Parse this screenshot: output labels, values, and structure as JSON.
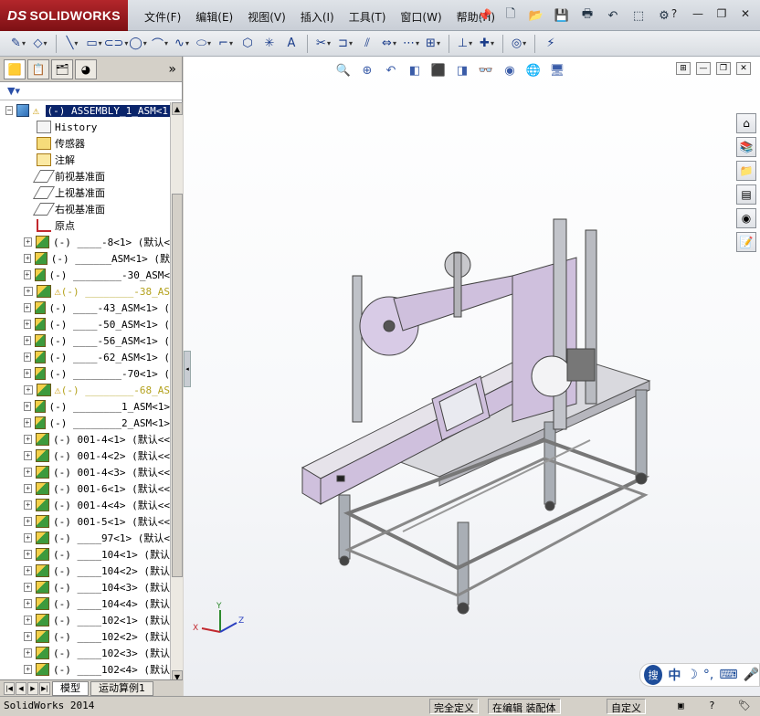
{
  "app": {
    "brand": "SOLIDWORKS",
    "brand_prefix": "DS"
  },
  "menu": [
    "文件(F)",
    "编辑(E)",
    "视图(V)",
    "插入(I)",
    "工具(T)",
    "窗口(W)",
    "帮助(H)"
  ],
  "feature_tree": {
    "root_label": "(-) ASSEMBLY_1_ASM<1",
    "items": [
      {
        "label": "History",
        "kind": "history",
        "indent": 2
      },
      {
        "label": "传感器",
        "kind": "sensor",
        "indent": 2
      },
      {
        "label": "注解",
        "kind": "annotation",
        "indent": 2
      },
      {
        "label": "前视基准面",
        "kind": "plane",
        "indent": 2
      },
      {
        "label": "上视基准面",
        "kind": "plane",
        "indent": 2
      },
      {
        "label": "右视基准面",
        "kind": "plane",
        "indent": 2
      },
      {
        "label": "原点",
        "kind": "origin",
        "indent": 2
      },
      {
        "label": "(-) ____-8<1> (默认<",
        "kind": "asm",
        "indent": 1
      },
      {
        "label": "(-) ______ASM<1> (默",
        "kind": "asm",
        "indent": 1
      },
      {
        "label": "(-) ________-30_ASM<",
        "kind": "asm",
        "indent": 1
      },
      {
        "label": "(-) ________-38_AS",
        "kind": "warn",
        "indent": 1
      },
      {
        "label": "(-) ____-43_ASM<1> (",
        "kind": "asm",
        "indent": 1
      },
      {
        "label": "(-) ____-50_ASM<1> (",
        "kind": "asm",
        "indent": 1
      },
      {
        "label": "(-) ____-56_ASM<1> (",
        "kind": "asm",
        "indent": 1
      },
      {
        "label": "(-) ____-62_ASM<1> (",
        "kind": "asm",
        "indent": 1
      },
      {
        "label": "(-) ________-70<1> (",
        "kind": "asm",
        "indent": 1
      },
      {
        "label": "(-) ________-68_AS",
        "kind": "warn",
        "indent": 1
      },
      {
        "label": "(-) ________1_ASM<1>",
        "kind": "asm",
        "indent": 1
      },
      {
        "label": "(-) ________2_ASM<1>",
        "kind": "asm",
        "indent": 1
      },
      {
        "label": "(-) 001-4<1> (默认<<",
        "kind": "part",
        "indent": 1
      },
      {
        "label": "(-) 001-4<2> (默认<<",
        "kind": "part",
        "indent": 1
      },
      {
        "label": "(-) 001-4<3> (默认<<",
        "kind": "part",
        "indent": 1
      },
      {
        "label": "(-) 001-6<1> (默认<<",
        "kind": "part",
        "indent": 1
      },
      {
        "label": "(-) 001-4<4> (默认<<",
        "kind": "part",
        "indent": 1
      },
      {
        "label": "(-) 001-5<1> (默认<<",
        "kind": "part",
        "indent": 1
      },
      {
        "label": "(-) ____97<1> (默认<",
        "kind": "part",
        "indent": 1
      },
      {
        "label": "(-) ____104<1> (默认",
        "kind": "part",
        "indent": 1
      },
      {
        "label": "(-) ____104<2> (默认",
        "kind": "part",
        "indent": 1
      },
      {
        "label": "(-) ____104<3> (默认",
        "kind": "part",
        "indent": 1
      },
      {
        "label": "(-) ____104<4> (默认",
        "kind": "part",
        "indent": 1
      },
      {
        "label": "(-) ____102<1> (默认",
        "kind": "part",
        "indent": 1
      },
      {
        "label": "(-) ____102<2> (默认",
        "kind": "part",
        "indent": 1
      },
      {
        "label": "(-) ____102<3> (默认",
        "kind": "part",
        "indent": 1
      },
      {
        "label": "(-) ____102<4> (默认",
        "kind": "part",
        "indent": 1
      }
    ]
  },
  "bottom_tabs": [
    "模型",
    "运动算例1"
  ],
  "status": {
    "app_version": "SolidWorks 2014",
    "defined": "完全定义",
    "editing": "在编辑 装配体",
    "custom": "自定义"
  },
  "ime": {
    "logo": "搜",
    "mode": "中"
  },
  "colors": {
    "brand_red": "#b3262b",
    "frame_silver": "#a9aeb5",
    "panel_purple": "#cfc0dd"
  }
}
